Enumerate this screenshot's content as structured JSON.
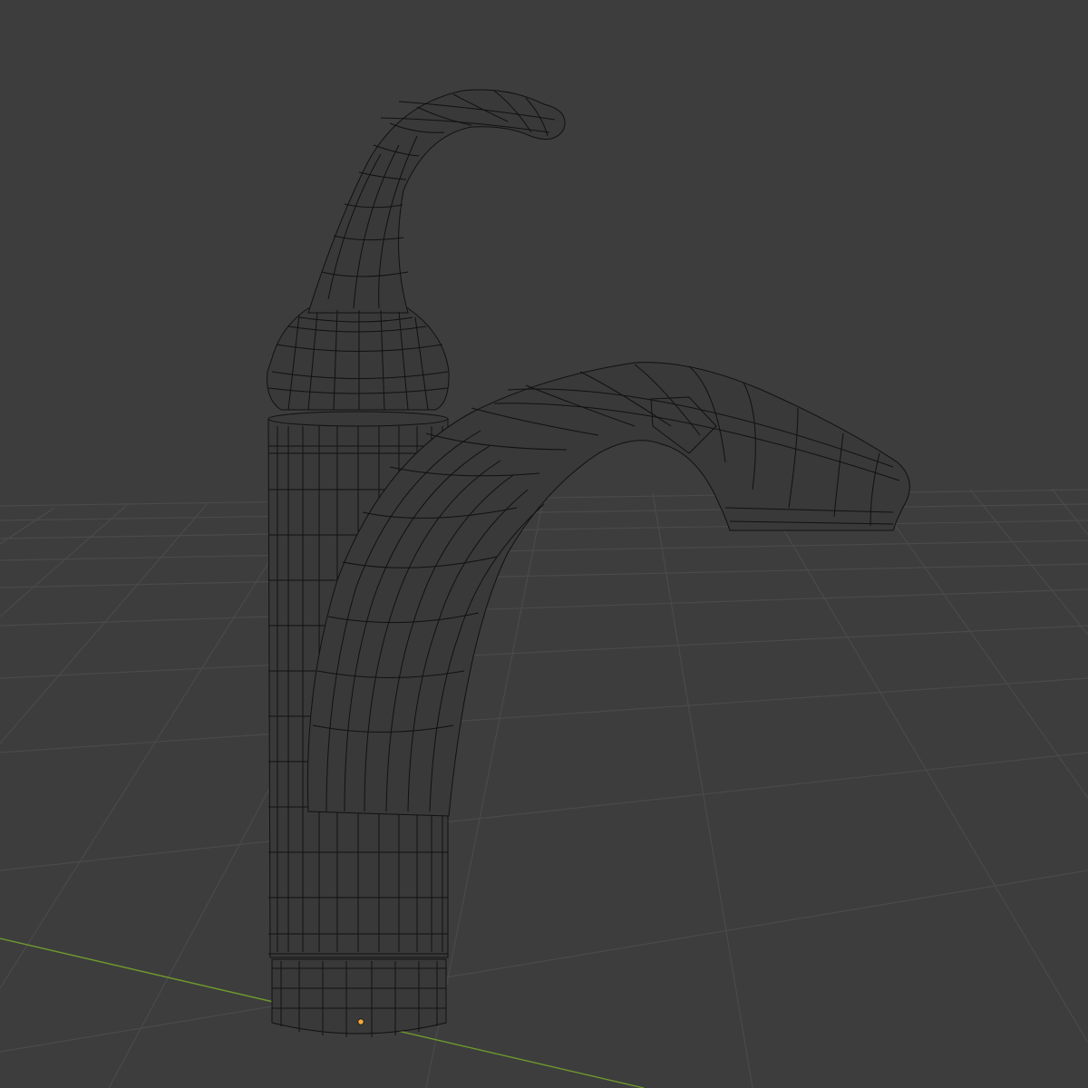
{
  "viewport": {
    "background_color": "#3d3d3d",
    "grid_color": "#4a4a4a",
    "x_axis_color": "#6f9a2e",
    "wire_color": "#111111",
    "mesh_fill_color": "#393939",
    "origin_color": "#f2a93a"
  },
  "scene": {
    "object_type": "faucet-mesh",
    "display_mode": "wireframe",
    "origin_marker": "object-origin",
    "parts": [
      "base-ring",
      "body-cylinder",
      "spout",
      "handle-knob",
      "handle-lever"
    ]
  }
}
